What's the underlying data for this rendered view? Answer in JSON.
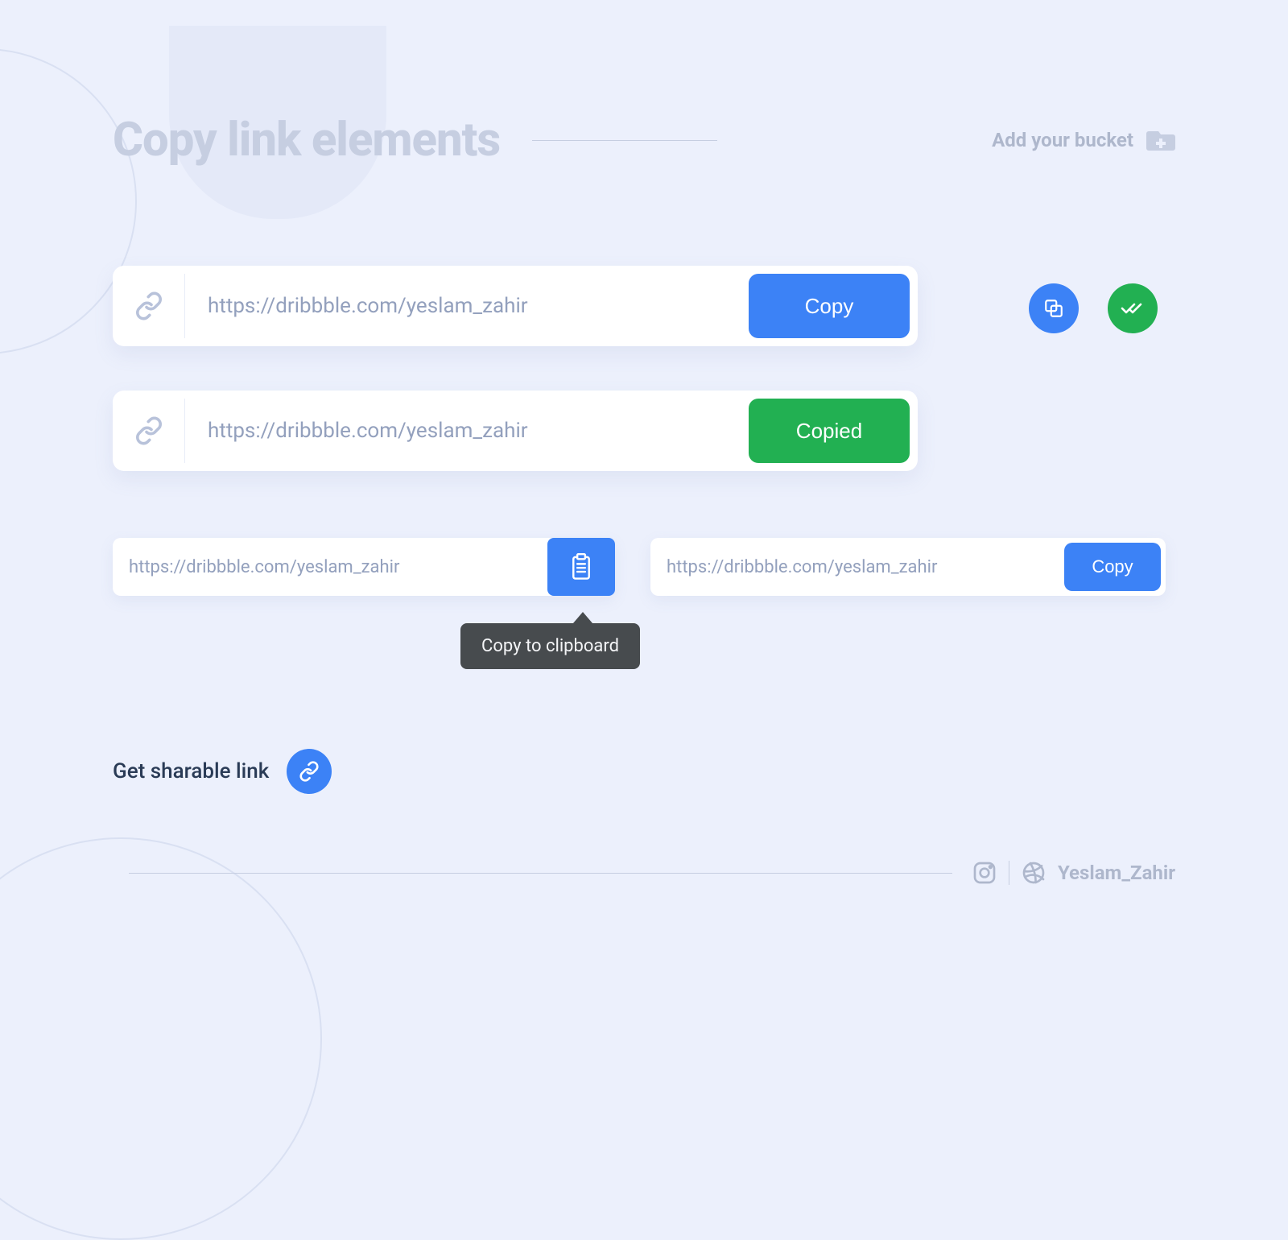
{
  "header": {
    "title": "Copy link elements",
    "add_bucket_label": "Add your bucket"
  },
  "rows": {
    "row1": {
      "url": "https://dribbble.com/yeslam_zahir",
      "button_label": "Copy"
    },
    "row2": {
      "url": "https://dribbble.com/yeslam_zahir",
      "button_label": "Copied"
    }
  },
  "small": {
    "left": {
      "url": "https://dribbble.com/yeslam_zahir"
    },
    "right": {
      "url": "https://dribbble.com/yeslam_zahir",
      "button_label": "Copy"
    }
  },
  "tooltip": "Copy to clipboard",
  "sharable": {
    "label": "Get sharable link"
  },
  "footer": {
    "author": "Yeslam_Zahir"
  },
  "colors": {
    "blue": "#3c82f6",
    "green": "#22b052",
    "bg": "#ecf0fc",
    "muted": "#c6cee1"
  }
}
